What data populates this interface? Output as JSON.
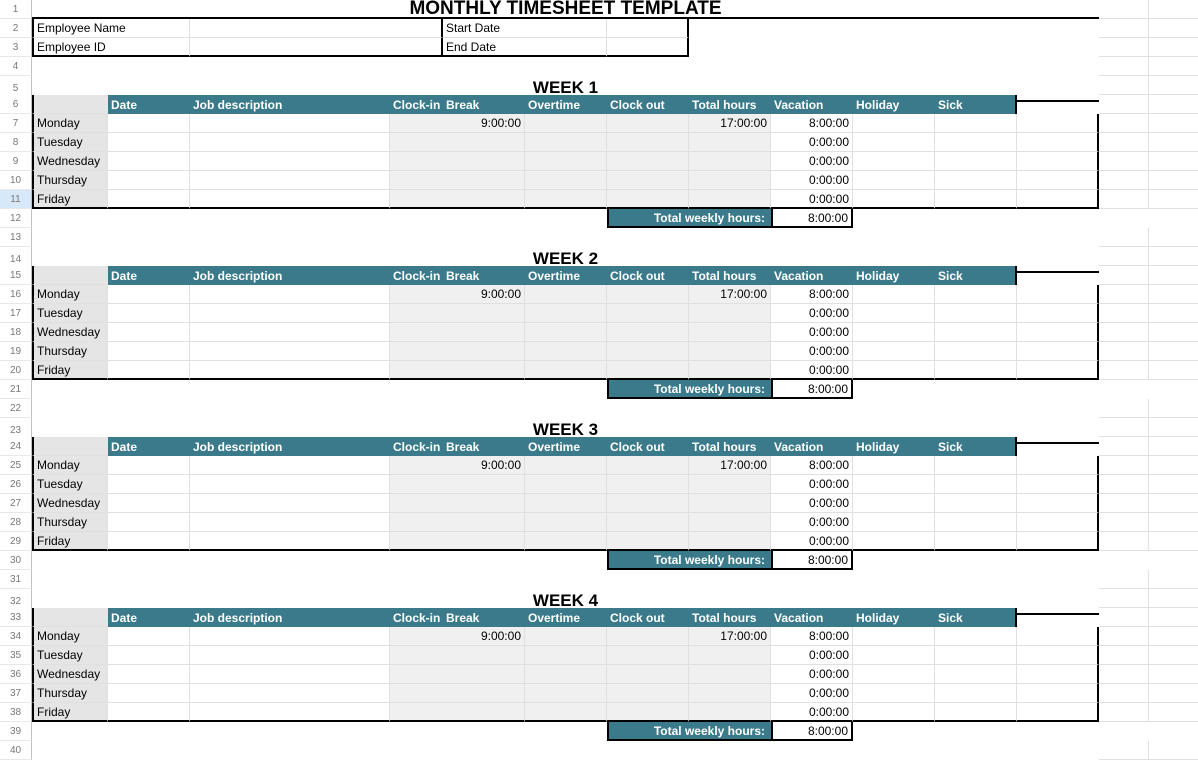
{
  "title": "MONTHLY TIMESHEET TEMPLATE",
  "employee": {
    "name_label": "Employee Name",
    "name_value": "",
    "id_label": "Employee ID",
    "id_value": "",
    "start_label": "Start Date",
    "start_value": "",
    "end_label": "End Date",
    "end_value": ""
  },
  "columns": [
    "Date",
    "Job description",
    "Clock-in",
    "Break",
    "Overtime",
    "Clock out",
    "Total hours",
    "Vacation",
    "Holiday",
    "Sick"
  ],
  "total_label": "Total weekly hours:",
  "days": [
    "Monday",
    "Tuesday",
    "Wednesday",
    "Thursday",
    "Friday"
  ],
  "weeks": [
    {
      "title": "WEEK 1",
      "total": "8:00:00",
      "rows": [
        {
          "clock_in": "9:00:00",
          "clock_out": "17:00:00",
          "total": "8:00:00"
        },
        {
          "clock_in": "",
          "clock_out": "",
          "total": "0:00:00"
        },
        {
          "clock_in": "",
          "clock_out": "",
          "total": "0:00:00"
        },
        {
          "clock_in": "",
          "clock_out": "",
          "total": "0:00:00"
        },
        {
          "clock_in": "",
          "clock_out": "",
          "total": "0:00:00"
        }
      ]
    },
    {
      "title": "WEEK 2",
      "total": "8:00:00",
      "rows": [
        {
          "clock_in": "9:00:00",
          "clock_out": "17:00:00",
          "total": "8:00:00"
        },
        {
          "clock_in": "",
          "clock_out": "",
          "total": "0:00:00"
        },
        {
          "clock_in": "",
          "clock_out": "",
          "total": "0:00:00"
        },
        {
          "clock_in": "",
          "clock_out": "",
          "total": "0:00:00"
        },
        {
          "clock_in": "",
          "clock_out": "",
          "total": "0:00:00"
        }
      ]
    },
    {
      "title": "WEEK 3",
      "total": "8:00:00",
      "rows": [
        {
          "clock_in": "9:00:00",
          "clock_out": "17:00:00",
          "total": "8:00:00"
        },
        {
          "clock_in": "",
          "clock_out": "",
          "total": "0:00:00"
        },
        {
          "clock_in": "",
          "clock_out": "",
          "total": "0:00:00"
        },
        {
          "clock_in": "",
          "clock_out": "",
          "total": "0:00:00"
        },
        {
          "clock_in": "",
          "clock_out": "",
          "total": "0:00:00"
        }
      ]
    },
    {
      "title": "WEEK 4",
      "total": "8:00:00",
      "rows": [
        {
          "clock_in": "9:00:00",
          "clock_out": "17:00:00",
          "total": "8:00:00"
        },
        {
          "clock_in": "",
          "clock_out": "",
          "total": "0:00:00"
        },
        {
          "clock_in": "",
          "clock_out": "",
          "total": "0:00:00"
        },
        {
          "clock_in": "",
          "clock_out": "",
          "total": "0:00:00"
        },
        {
          "clock_in": "",
          "clock_out": "",
          "total": "0:00:00"
        }
      ]
    }
  ],
  "selected_row": 11
}
